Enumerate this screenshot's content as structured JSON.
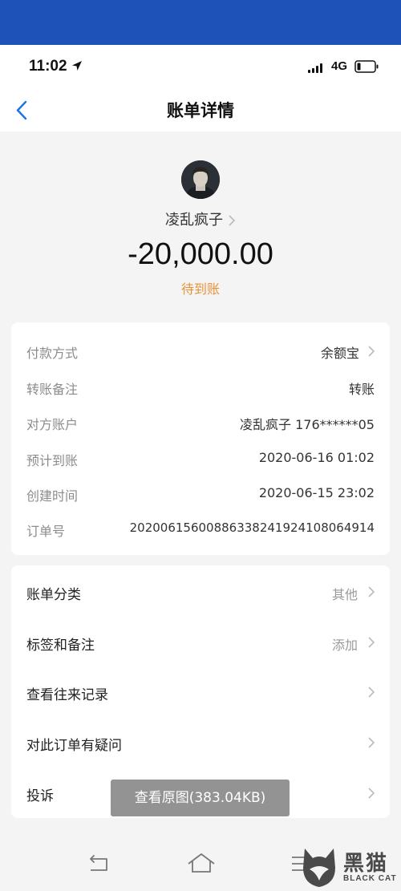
{
  "status_bar": {
    "time": "11:02",
    "network": "4G"
  },
  "nav": {
    "title": "账单详情"
  },
  "payee": {
    "name": "凌乱疯子",
    "amount": "-20,000.00",
    "status": "待到账"
  },
  "details": [
    {
      "label": "付款方式",
      "value": "余额宝",
      "chevron": true
    },
    {
      "label": "转账备注",
      "value": "转账",
      "chevron": false
    },
    {
      "label": "对方账户",
      "value": "凌乱疯子 176******05",
      "chevron": false
    },
    {
      "label": "预计到账",
      "value": "2020-06-16 01:02",
      "chevron": false
    },
    {
      "label": "创建时间",
      "value": "2020-06-15 23:02",
      "chevron": false
    },
    {
      "label": "订单号",
      "value": "20200615600886338241924108064914",
      "chevron": false
    }
  ],
  "menu": [
    {
      "label": "账单分类",
      "value": "其他"
    },
    {
      "label": "标签和备注",
      "value": "添加"
    },
    {
      "label": "查看往来记录",
      "value": ""
    },
    {
      "label": "对此订单有疑问",
      "value": ""
    },
    {
      "label": "投诉",
      "value": ""
    }
  ],
  "overlay": {
    "label": "查看原图(383.04KB)"
  },
  "watermark": {
    "title": "黑猫",
    "subtitle": "BLACK CAT"
  },
  "colors": {
    "top_band": "#1f52b8",
    "accent_blue": "#1a73e8",
    "pending_orange": "#e8923a",
    "background": "#f4f4f4"
  },
  "icons": {
    "back": "chevron-left-icon",
    "row": "chevron-right-icon",
    "location": "location-arrow-icon"
  }
}
